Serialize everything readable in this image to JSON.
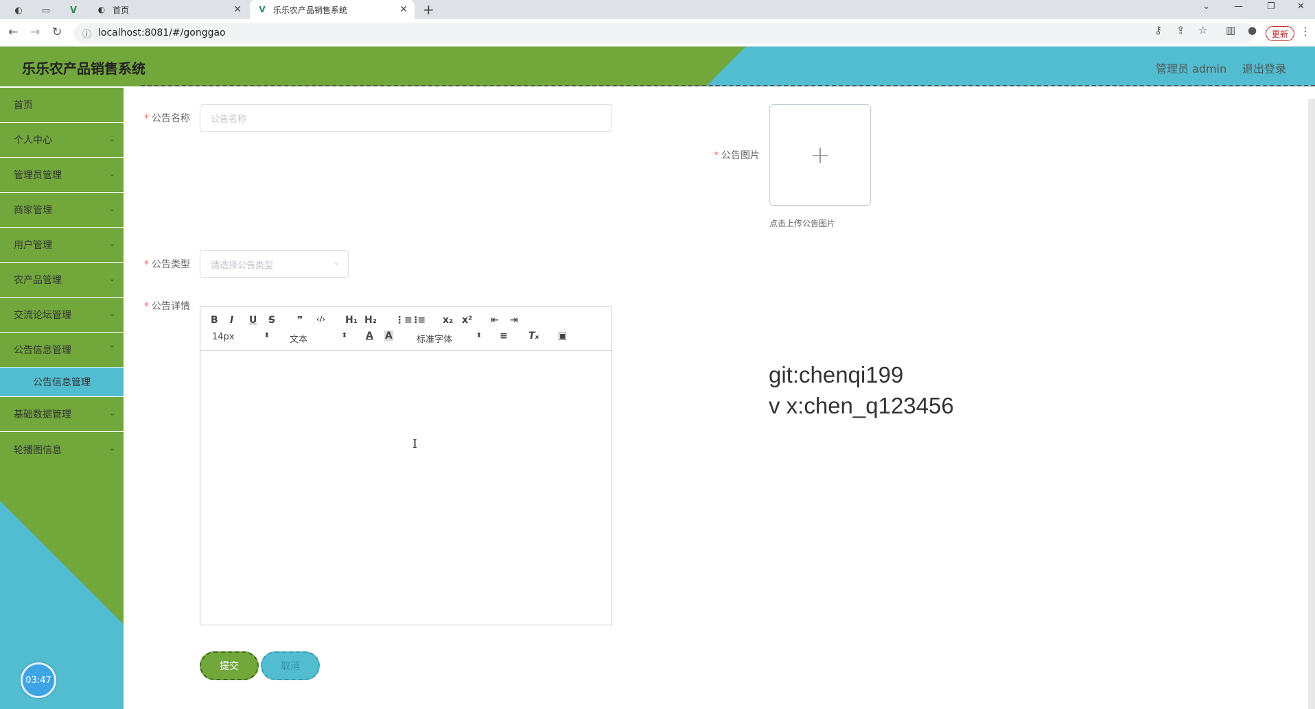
{
  "browser": {
    "tabs": [
      {
        "label": "首页",
        "active": false
      },
      {
        "label": "乐乐农产品销售系统",
        "active": true
      }
    ],
    "url": "localhost:8081/#/gonggao",
    "update_label": "更新"
  },
  "header": {
    "title": "乐乐农产品销售系统",
    "user": "管理员 admin",
    "logout": "退出登录"
  },
  "sidebar": {
    "items": [
      {
        "label": "首页"
      },
      {
        "label": "个人中心"
      },
      {
        "label": "管理员管理"
      },
      {
        "label": "商家管理"
      },
      {
        "label": "用户管理"
      },
      {
        "label": "农产品管理"
      },
      {
        "label": "交流论坛管理"
      },
      {
        "label": "公告信息管理"
      },
      {
        "label": "基础数据管理"
      },
      {
        "label": "轮播图信息"
      }
    ],
    "active_sub": "公告信息管理",
    "clock": "03:47"
  },
  "form": {
    "name_label": "公告名称",
    "name_placeholder": "公告名称",
    "image_label": "公告图片",
    "image_hint": "点击上传公告图片",
    "type_label": "公告类型",
    "type_placeholder": "请选择公告类型",
    "detail_label": "公告详情",
    "editor": {
      "font_size": "14px",
      "header": "文本",
      "font": "标准字体"
    },
    "submit": "提交",
    "cancel": "取消"
  },
  "watermark": {
    "line1": "git:chenqi199",
    "line2": "v x:chen_q123456"
  }
}
